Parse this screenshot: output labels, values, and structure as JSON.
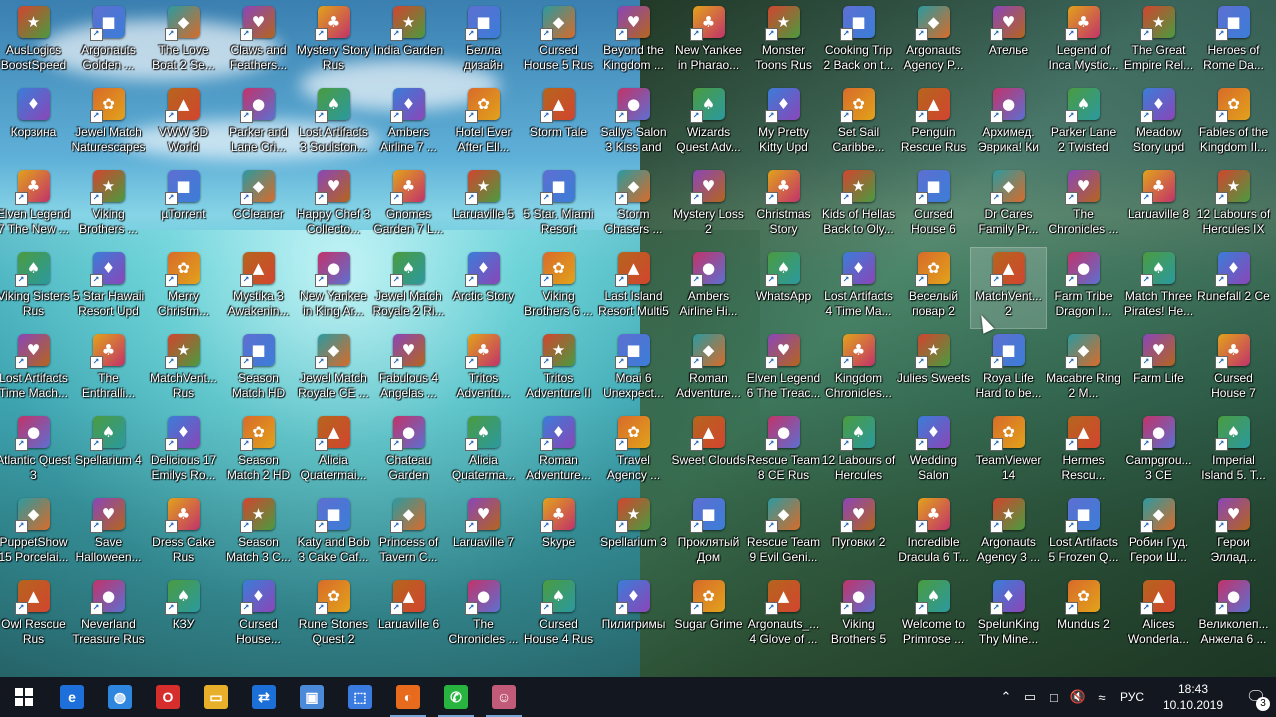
{
  "desktop": {
    "columns": [
      [
        "AusLogics BoostSpeed",
        "Корзина",
        "Elven Legend 7 The New ...",
        "Viking Sisters Rus",
        "Lost Artifacts Time Mach...",
        "Atlantic Quest 3",
        "PuppetShow 15 Porcelai...",
        "Owl Rescue Rus"
      ],
      [
        "Argonauts Golden ...",
        "Jewel Match Naturescapes",
        "Viking Brothers ...",
        "5 Star Hawaii Resort Upd",
        "The Enthralli...",
        "Spellarium 4",
        "Save Halloween...",
        "Neverland Treasure Rus"
      ],
      [
        "The Love Boat 2 Se...",
        "VWW 3D World",
        "µTorrent",
        "Merry Christm...",
        "MatchVent... Rus",
        "Delicious 17 Emilys Ro...",
        "Dress Cake Rus",
        "КЗУ"
      ],
      [
        "Claws and Feathers...",
        "Parker and Lane Cri...",
        "CCleaner",
        "Mystika 3 Awakenin...",
        "Season Match HD",
        "Season Match 2 HD",
        "Season Match 3 C...",
        "Cursed House..."
      ],
      [
        "Mystery Story Rus",
        "Lost Artifacts 3 Soulston...",
        "Happy Chef 3 Collecto...",
        "New Yankee in King Ar...",
        "Jewel Match Royale CE ...",
        "Alicia Quatermai...",
        "Katy and Bob 3 Cake Caf...",
        "Rune Stones Quest 2"
      ],
      [
        "India Garden",
        "Ambers Airline 7 ...",
        "Gnomes Garden 7 L...",
        "Jewel Match Royale 2 Ri...",
        "Fabulous 4 Angelas ...",
        "Chateau Garden",
        "Princess of Tavern C...",
        "Laruaville 6"
      ],
      [
        "Белла дизайн",
        "Hotel Ever After Ell...",
        "Laruaville 5",
        "Arctic Story",
        "Tritos Adventu...",
        "Alicia Quaterma...",
        "Laruaville 7",
        "The Chronicles ..."
      ],
      [
        "Cursed House 5 Rus",
        "Storm Tale",
        "5 Star. Miami Resort",
        "Viking Brothers 6 ...",
        "Tritos Adventure II",
        "Roman Adventure...",
        "Skype",
        "Cursed House 4 Rus"
      ],
      [
        "Beyond the Kingdom ...",
        "Sallys Salon 3 Kiss and M...",
        "Storm Chasers ...",
        "Last Island Resort Multi5",
        "Moai 6 Unexpect...",
        "Travel Agency ...",
        "Spellarium 3",
        "Пилигримы"
      ],
      [
        "New Yankee in Pharao...",
        "Wizards Quest Adv...",
        "Mystery Loss 2",
        "Ambers Airline Hi...",
        "Roman Adventure...",
        "Sweet Clouds",
        "Проклятый Дом",
        "Sugar Grime"
      ],
      [
        "Monster Toons Rus",
        "My Pretty Kitty Upd",
        "Christmas Story",
        "WhatsApp",
        "Elven Legend 6 The Treac...",
        "Rescue Team 8 CE Rus",
        "Rescue Team 9 Evil Geni...",
        "Argonauts_... 4 Glove of ..."
      ],
      [
        "Cooking Trip 2 Back on t...",
        "Set Sail Caribbe...",
        "Kids of Hellas Back to Oly...",
        "Lost Artifacts 4 Time Ma...",
        "Kingdom Chronicles...",
        "12 Labours of Hercules VII...",
        "Пуговки 2",
        "Viking Brothers 5"
      ],
      [
        "Argonauts Agency P...",
        "Penguin Rescue Rus",
        "Cursed House 6",
        "Веселый повар 2",
        "Julies Sweets",
        "Wedding Salon",
        "Incredible Dracula 6 T...",
        "Welcome to Primrose ..."
      ],
      [
        "Ателье",
        "Архимед. Эврика! Ки",
        "Dr Cares Family Pr...",
        "MatchVent... 2",
        "Roya Life Hard to be...",
        "TeamViewer 14",
        "Argonauts Agency 3 ...",
        "SpelunKing Thy Mine..."
      ],
      [
        "Legend of Inca Mystic...",
        "Parker Lane 2 Twisted Mi...",
        "The Chronicles ...",
        "Farm Tribe Dragon I...",
        "Macabre Ring 2 M...",
        "Hermes Rescu...",
        "Lost Artifacts 5 Frozen Q...",
        "Mundus 2"
      ],
      [
        "The Great Empire Rel...",
        "Meadow Story upd",
        "Laruaville 8",
        "Match Three Pirates! He...",
        "Farm Life",
        "Campgrou... 3 CE",
        "Робин Гуд. Герои Ш...",
        "Alices Wonderla..."
      ],
      [
        "Heroes of Rome Da...",
        "Fables of the Kingdom II...",
        "12 Labours of Hercules IX ...",
        "Runefall 2 Ce",
        "Cursed House 7",
        "Imperial Island 5. T...",
        "Герои Эллад...",
        "Великолеп... Анжела 6 ..."
      ]
    ],
    "selected_icon": "MatchVent... 2"
  },
  "taskbar": {
    "start": "start-icon",
    "pinned": [
      "edge-icon",
      "globe-icon",
      "opera-icon",
      "explorer-icon",
      "teamviewer-icon",
      "window-icon",
      "snip-icon",
      "firefox-icon",
      "whatsapp-icon",
      "game-icon"
    ],
    "lang": "РУС",
    "time": "18:43",
    "date": "10.10.2019",
    "notifications": "3"
  }
}
